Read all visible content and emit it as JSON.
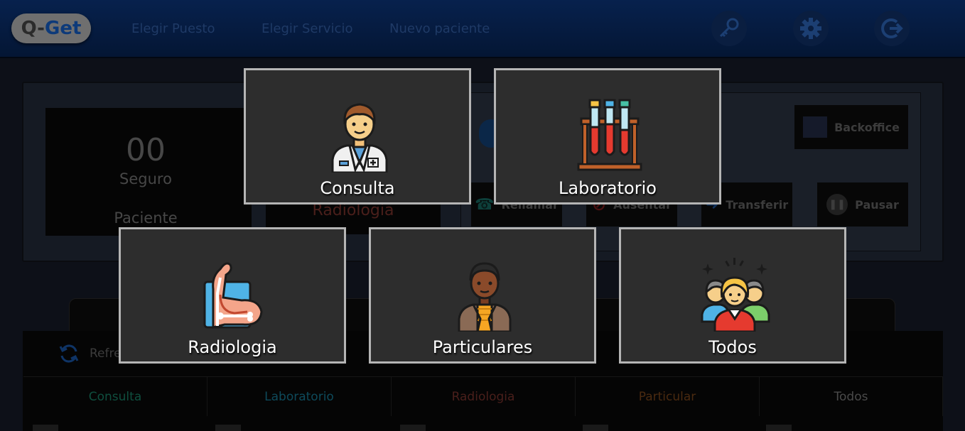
{
  "app": {
    "logo_q": "Q-",
    "logo_get": "Get"
  },
  "nav": {
    "items": [
      {
        "label": "Elegir Puesto"
      },
      {
        "label": "Elegir Servicio"
      },
      {
        "label": "Nuevo paciente"
      }
    ],
    "icons": [
      "key-icon",
      "gear-icon",
      "logout-icon"
    ]
  },
  "counter": {
    "number": "00",
    "insurance": "Seguro",
    "patient_label": "Paciente"
  },
  "current_service": "Radiologia",
  "actions": {
    "backoffice": "Backoffice",
    "rellamar": "Rellamar",
    "ausentar": "Ausentar",
    "transferir": "Transferir",
    "pausar": "Pausar",
    "refresh": "Refrescar"
  },
  "table": {
    "columns": [
      {
        "label": "Consulta",
        "color": "#0f4f3f"
      },
      {
        "label": "Laboratorio",
        "color": "#0e4a5b"
      },
      {
        "label": "Radiologia",
        "color": "#4a1f1b"
      },
      {
        "label": "Particular",
        "color": "#4a2a10"
      },
      {
        "label": "Todos",
        "color": "#4a4a4a"
      }
    ]
  },
  "services": [
    {
      "label": "Consulta",
      "icon": "doctor-icon"
    },
    {
      "label": "Laboratorio",
      "icon": "test-tubes-icon"
    },
    {
      "label": "Radiologia",
      "icon": "xray-arm-icon"
    },
    {
      "label": "Particulares",
      "icon": "person-icon"
    },
    {
      "label": "Todos",
      "icon": "group-icon"
    }
  ]
}
